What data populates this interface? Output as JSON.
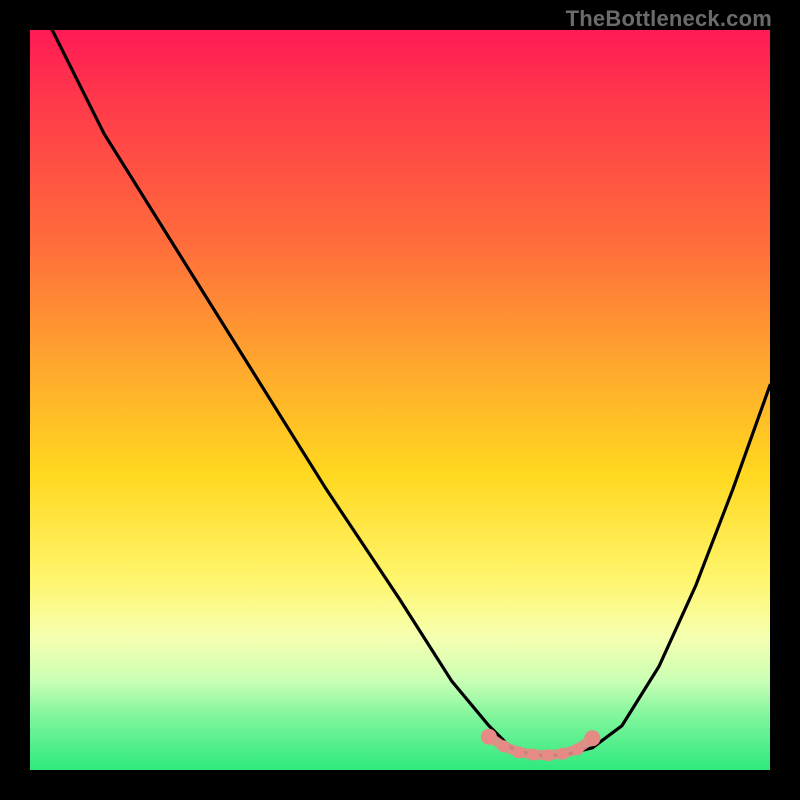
{
  "watermark": "TheBottleneck.com",
  "chart_data": {
    "type": "line",
    "title": "",
    "xlabel": "",
    "ylabel": "",
    "xlim": [
      0,
      100
    ],
    "ylim": [
      0,
      100
    ],
    "grid": false,
    "legend": false,
    "series": [
      {
        "name": "bottleneck-curve",
        "color": "#000000",
        "x": [
          3,
          10,
          20,
          30,
          40,
          50,
          57,
          62,
          65,
          68,
          72,
          76,
          80,
          85,
          90,
          95,
          100
        ],
        "y": [
          100,
          86,
          70,
          54,
          38,
          23,
          12,
          6,
          3,
          2,
          2,
          3,
          6,
          14,
          25,
          38,
          52
        ]
      },
      {
        "name": "optimal-band-markers",
        "color": "#e58a85",
        "x": [
          62,
          64,
          66,
          68,
          70,
          72,
          74,
          76
        ],
        "y": [
          4.5,
          3.2,
          2.4,
          2.1,
          2.0,
          2.2,
          2.8,
          4.3
        ]
      }
    ],
    "annotations": []
  }
}
